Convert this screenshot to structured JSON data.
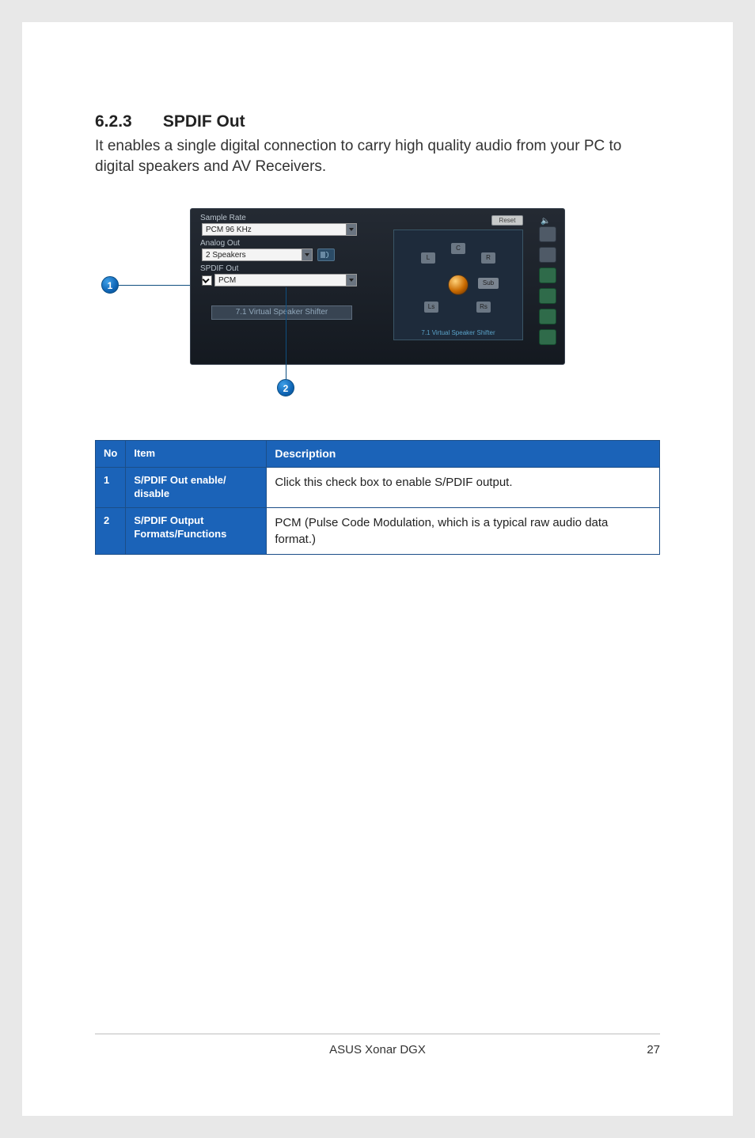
{
  "heading": {
    "number": "6.2.3",
    "title": "SPDIF Out"
  },
  "intro": "It enables a single digital connection to carry high quality audio from your PC to digital speakers and AV Receivers.",
  "panel": {
    "sample_rate_label": "Sample Rate",
    "sample_rate_value": "PCM 96 KHz",
    "analog_out_label": "Analog Out",
    "analog_out_value": "2 Speakers",
    "spdif_out_label": "SPDIF Out",
    "spdif_out_value": "PCM",
    "vss_button": "7.1 Virtual Speaker Shifter",
    "reset": "Reset",
    "preview_caption": "7.1 Virtual Speaker Shifter",
    "speakers": {
      "l": "L",
      "r": "R",
      "c": "C",
      "sub": "Sub",
      "ls": "Ls",
      "rs": "Rs"
    }
  },
  "callouts": {
    "one": "1",
    "two": "2"
  },
  "table": {
    "headers": {
      "no": "No",
      "item": "Item",
      "desc": "Description"
    },
    "rows": [
      {
        "no": "1",
        "item": "S/PDIF Out enable/\ndisable",
        "desc": "Click this check box to enable S/PDIF output."
      },
      {
        "no": "2",
        "item": "S/PDIF Output Formats/Functions",
        "desc": "PCM (Pulse Code Modulation, which is a typical raw audio data format.)"
      }
    ]
  },
  "footer": {
    "center": "ASUS Xonar DGX",
    "page": "27"
  }
}
